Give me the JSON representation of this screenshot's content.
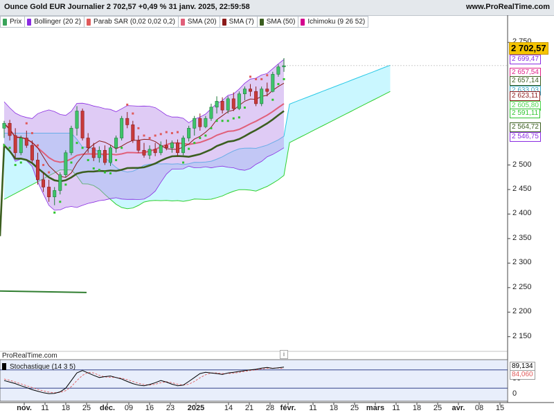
{
  "header": {
    "title": "Ounce Gold EUR Journalier 2 702,57 +0,49 % 31 janv. 2025, 22:59:58",
    "brand": "www.ProRealTime.com"
  },
  "legend": [
    {
      "label": "Prix",
      "color": "#3aa35a"
    },
    {
      "label": "Bollinger (20 2)",
      "color": "#8a2be2"
    },
    {
      "label": "Parab SAR (0,02 0,02 0,2)",
      "color": "#e05a5a"
    },
    {
      "label": "SMA (20)",
      "color": "#e0607a"
    },
    {
      "label": "SMA (7)",
      "color": "#8b1a1a"
    },
    {
      "label": "SMA (50)",
      "color": "#3b5e1f"
    },
    {
      "label": "Ichimoku (9 26 52)",
      "color": "#d4008e"
    }
  ],
  "price_axis": {
    "ticks": [
      "2 750",
      "2 500",
      "2 450",
      "2 400",
      "2 350",
      "2 300",
      "2 250",
      "2 200",
      "2 150"
    ],
    "tags": [
      {
        "text": "2 702,57",
        "color": "#000000",
        "bg": "#f5c400"
      },
      {
        "text": "2 699,47",
        "color": "#8a2be2",
        "bg": "#ffffff"
      },
      {
        "text": "2 657,54",
        "color": "#e0208a",
        "bg": "#ffffff"
      },
      {
        "text": "2 657,14",
        "color": "#3b5e1f",
        "bg": "#ffffff"
      },
      {
        "text": "2 633,03",
        "color": "#3aa5c0",
        "bg": "#ffffff"
      },
      {
        "text": "2 623,11",
        "color": "#8b1a1a",
        "bg": "#ffffff"
      },
      {
        "text": "2 605,80",
        "color": "#4cd64c",
        "bg": "#ffffff"
      },
      {
        "text": "2 591,11",
        "color": "#2ec42e",
        "bg": "#ffffff"
      },
      {
        "text": "2 564,72",
        "color": "#3b5e1f",
        "bg": "#ffffff"
      },
      {
        "text": "2 546,75",
        "color": "#8a2be2",
        "bg": "#ffffff"
      }
    ]
  },
  "stochastic": {
    "label": "Stochastique (14 3 5)",
    "color": "#000000",
    "ticks": [
      "50",
      "0"
    ],
    "tags": [
      {
        "text": "89,134",
        "color": "#000000"
      },
      {
        "text": "84,060",
        "color": "#e05a5a"
      }
    ]
  },
  "source_label": "ProRealTime.com",
  "info_label": "i",
  "time_axis": [
    {
      "text": "nov.",
      "bold": true
    },
    {
      "text": "11",
      "bold": false
    },
    {
      "text": "18",
      "bold": false
    },
    {
      "text": "25",
      "bold": false
    },
    {
      "text": "déc.",
      "bold": true
    },
    {
      "text": "09",
      "bold": false
    },
    {
      "text": "16",
      "bold": false
    },
    {
      "text": "23",
      "bold": false
    },
    {
      "text": "2025",
      "bold": true
    },
    {
      "text": "14",
      "bold": false
    },
    {
      "text": "21",
      "bold": false
    },
    {
      "text": "28",
      "bold": false
    },
    {
      "text": "févr.",
      "bold": true
    },
    {
      "text": "11",
      "bold": false
    },
    {
      "text": "18",
      "bold": false
    },
    {
      "text": "25",
      "bold": false
    },
    {
      "text": "mars",
      "bold": true
    },
    {
      "text": "11",
      "bold": false
    },
    {
      "text": "18",
      "bold": false
    },
    {
      "text": "25",
      "bold": false
    },
    {
      "text": "avr.",
      "bold": true
    },
    {
      "text": "08",
      "bold": false
    },
    {
      "text": "15",
      "bold": false
    }
  ],
  "chart_data": {
    "type": "candlestick",
    "title": "Ounce Gold EUR Journalier 2 702,57 +0,49 % 31 janv. 2025, 22:59:58",
    "ylim": [
      2120,
      2780
    ],
    "stoch_ylim": [
      0,
      100
    ],
    "candles": [
      {
        "o": 2575,
        "h": 2590,
        "l": 2555,
        "c": 2585
      },
      {
        "o": 2585,
        "h": 2592,
        "l": 2550,
        "c": 2560
      },
      {
        "o": 2560,
        "h": 2575,
        "l": 2515,
        "c": 2525
      },
      {
        "o": 2525,
        "h": 2560,
        "l": 2520,
        "c": 2555
      },
      {
        "o": 2555,
        "h": 2570,
        "l": 2535,
        "c": 2540
      },
      {
        "o": 2540,
        "h": 2550,
        "l": 2505,
        "c": 2510
      },
      {
        "o": 2510,
        "h": 2525,
        "l": 2460,
        "c": 2470
      },
      {
        "o": 2470,
        "h": 2485,
        "l": 2445,
        "c": 2455
      },
      {
        "o": 2455,
        "h": 2470,
        "l": 2425,
        "c": 2435
      },
      {
        "o": 2435,
        "h": 2455,
        "l": 2418,
        "c": 2448
      },
      {
        "o": 2448,
        "h": 2485,
        "l": 2440,
        "c": 2480
      },
      {
        "o": 2480,
        "h": 2530,
        "l": 2475,
        "c": 2525
      },
      {
        "o": 2525,
        "h": 2580,
        "l": 2520,
        "c": 2575
      },
      {
        "o": 2575,
        "h": 2620,
        "l": 2560,
        "c": 2610
      },
      {
        "o": 2610,
        "h": 2615,
        "l": 2550,
        "c": 2555
      },
      {
        "o": 2555,
        "h": 2565,
        "l": 2525,
        "c": 2535
      },
      {
        "o": 2535,
        "h": 2545,
        "l": 2508,
        "c": 2515
      },
      {
        "o": 2515,
        "h": 2538,
        "l": 2505,
        "c": 2530
      },
      {
        "o": 2530,
        "h": 2540,
        "l": 2500,
        "c": 2505
      },
      {
        "o": 2505,
        "h": 2540,
        "l": 2498,
        "c": 2535
      },
      {
        "o": 2535,
        "h": 2560,
        "l": 2525,
        "c": 2555
      },
      {
        "o": 2555,
        "h": 2600,
        "l": 2550,
        "c": 2595
      },
      {
        "o": 2595,
        "h": 2608,
        "l": 2575,
        "c": 2582
      },
      {
        "o": 2582,
        "h": 2590,
        "l": 2545,
        "c": 2550
      },
      {
        "o": 2550,
        "h": 2560,
        "l": 2525,
        "c": 2530
      },
      {
        "o": 2530,
        "h": 2545,
        "l": 2515,
        "c": 2520
      },
      {
        "o": 2520,
        "h": 2540,
        "l": 2512,
        "c": 2532
      },
      {
        "o": 2532,
        "h": 2545,
        "l": 2518,
        "c": 2525
      },
      {
        "o": 2525,
        "h": 2548,
        "l": 2520,
        "c": 2540
      },
      {
        "o": 2540,
        "h": 2552,
        "l": 2530,
        "c": 2535
      },
      {
        "o": 2535,
        "h": 2550,
        "l": 2525,
        "c": 2545
      },
      {
        "o": 2545,
        "h": 2552,
        "l": 2518,
        "c": 2525
      },
      {
        "o": 2525,
        "h": 2560,
        "l": 2520,
        "c": 2555
      },
      {
        "o": 2555,
        "h": 2580,
        "l": 2548,
        "c": 2575
      },
      {
        "o": 2575,
        "h": 2600,
        "l": 2560,
        "c": 2595
      },
      {
        "o": 2595,
        "h": 2605,
        "l": 2570,
        "c": 2578
      },
      {
        "o": 2578,
        "h": 2600,
        "l": 2575,
        "c": 2595
      },
      {
        "o": 2595,
        "h": 2625,
        "l": 2590,
        "c": 2618
      },
      {
        "o": 2618,
        "h": 2640,
        "l": 2605,
        "c": 2630
      },
      {
        "o": 2630,
        "h": 2638,
        "l": 2605,
        "c": 2612
      },
      {
        "o": 2612,
        "h": 2640,
        "l": 2605,
        "c": 2635
      },
      {
        "o": 2635,
        "h": 2648,
        "l": 2610,
        "c": 2615
      },
      {
        "o": 2615,
        "h": 2650,
        "l": 2612,
        "c": 2645
      },
      {
        "o": 2645,
        "h": 2660,
        "l": 2632,
        "c": 2655
      },
      {
        "o": 2655,
        "h": 2665,
        "l": 2640,
        "c": 2650
      },
      {
        "o": 2650,
        "h": 2660,
        "l": 2620,
        "c": 2625
      },
      {
        "o": 2625,
        "h": 2660,
        "l": 2620,
        "c": 2655
      },
      {
        "o": 2655,
        "h": 2668,
        "l": 2640,
        "c": 2650
      },
      {
        "o": 2650,
        "h": 2690,
        "l": 2648,
        "c": 2685
      },
      {
        "o": 2685,
        "h": 2705,
        "l": 2680,
        "c": 2700
      },
      {
        "o": 2700,
        "h": 2718,
        "l": 2690,
        "c": 2702.57
      }
    ],
    "stochastic_k": [
      45,
      40,
      35,
      28,
      22,
      15,
      10,
      5,
      2,
      3,
      8,
      20,
      45,
      70,
      78,
      70,
      62,
      55,
      58,
      60,
      55,
      50,
      42,
      35,
      30,
      28,
      32,
      38,
      45,
      40,
      33,
      28,
      30,
      42,
      55,
      68,
      72,
      70,
      68,
      65,
      70,
      72,
      75,
      78,
      80,
      82,
      86,
      88,
      85,
      87,
      89.134
    ],
    "stochastic_d": [
      50,
      46,
      40,
      34,
      28,
      22,
      16,
      11,
      7,
      5,
      6,
      12,
      25,
      45,
      62,
      72,
      70,
      62,
      57,
      56,
      55,
      53,
      48,
      42,
      36,
      32,
      30,
      33,
      38,
      41,
      38,
      33,
      30,
      33,
      42,
      54,
      64,
      70,
      70,
      68,
      68,
      69,
      72,
      75,
      78,
      80,
      83,
      85,
      86,
      86,
      84.06
    ]
  }
}
